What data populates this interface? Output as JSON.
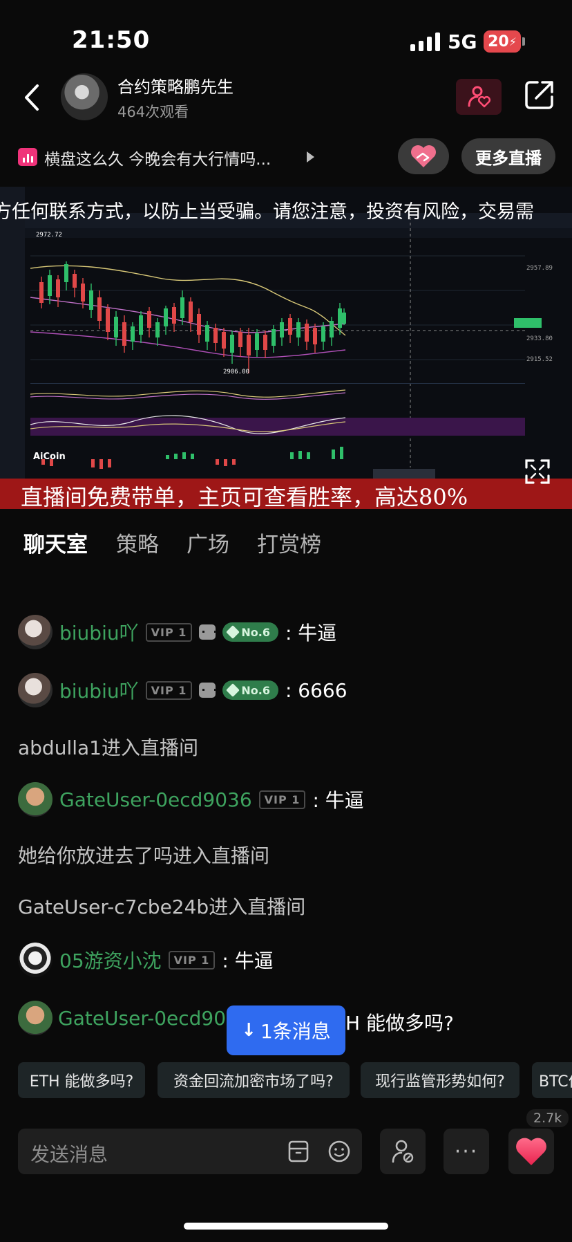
{
  "status_bar": {
    "time": "21:50",
    "network": "5G",
    "battery": "20"
  },
  "header": {
    "host_name": "合约策略鹏先生",
    "views": "464次观看"
  },
  "ticker": {
    "topic": "横盘这么久 今晚会有大行情吗...",
    "more_live": "更多直播"
  },
  "video": {
    "notice": "方任何联系方式，以防上当受骗。请您注意，投资有风险，交易需",
    "banner": "直播间免费带单，主页可查看胜率，高达80%"
  },
  "tabs": [
    "聊天室",
    "策略",
    "广场",
    "打赏榜"
  ],
  "chat": [
    {
      "user": "biubiu吖",
      "vip": "VIP 1",
      "rank": "No.6",
      "text": ": 牛逼"
    },
    {
      "user": "biubiu吖",
      "vip": "VIP 1",
      "rank": "No.6",
      "text": ": 6666"
    },
    {
      "system": "abdulla1进入直播间"
    },
    {
      "user": "GateUser-0ecd9036",
      "vip": "VIP 1",
      "text": ": 牛逼"
    },
    {
      "system": "她给你放进去了吗进入直播间"
    },
    {
      "system": "GateUser-c7cbe24b进入直播间"
    },
    {
      "user": "05游资小沈",
      "vip": "VIP 1",
      "text": ": 牛逼"
    },
    {
      "user": "GateUser-0ecd90",
      "text": "H 能做多吗?"
    }
  ],
  "new_message": "1条消息",
  "quick_questions": [
    "ETH 能做多吗?",
    "资金回流加密市场了吗?",
    "现行监管形势如何?",
    "BTC价"
  ],
  "input": {
    "placeholder": "发送消息"
  },
  "likes": "2.7k",
  "colors": {
    "accent_green": "#3ea35f",
    "new_message_blue": "#2f6bf0",
    "banner_red": "#9e1717",
    "like_pink": "#f0406a"
  }
}
